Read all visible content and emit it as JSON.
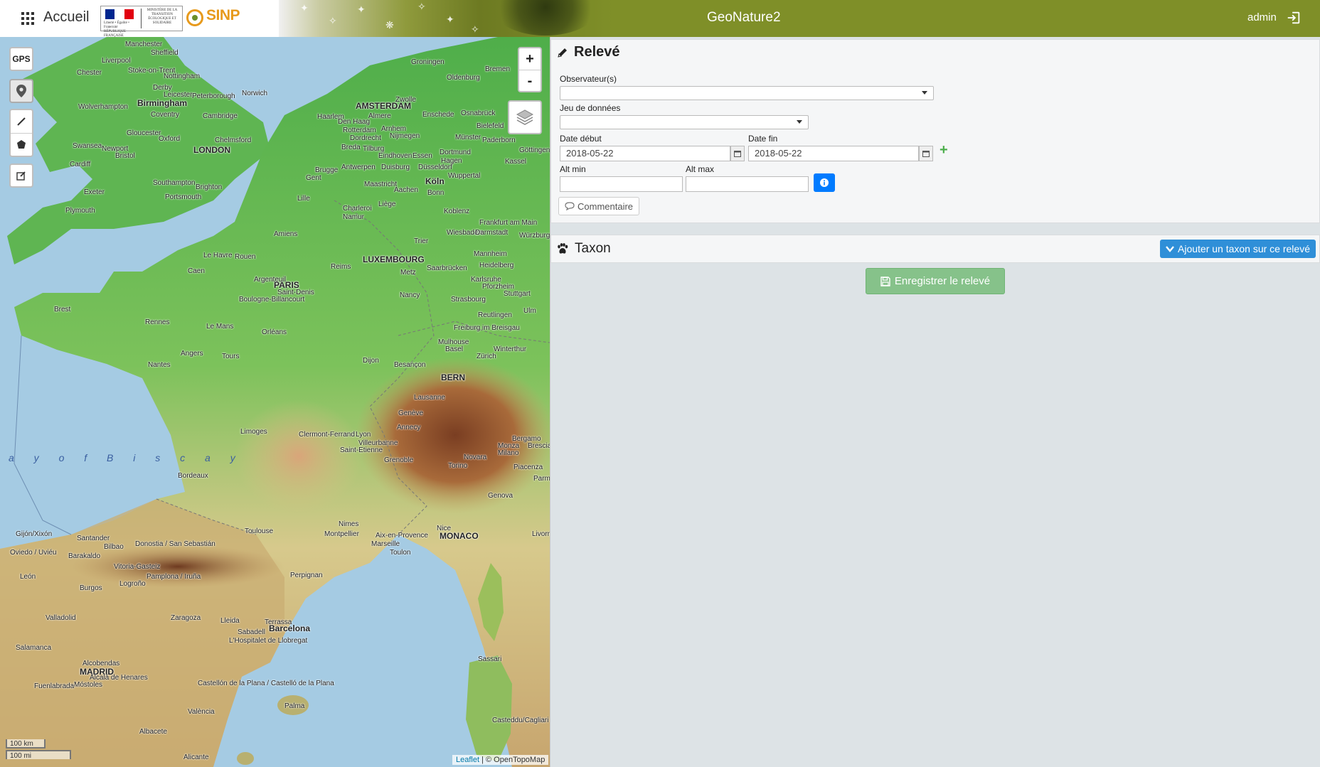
{
  "header": {
    "home_label": "Accueil",
    "app_title": "GeoNature2",
    "user": "admin",
    "logo_sinp": "SINP",
    "logo_rf_text": "Liberté • Égalité • Fraternité RÉPUBLIQUE FRANÇAISE",
    "logo_ministry": "MINISTÈRE DE LA TRANSITION ÉCOLOGIQUE ET SOLIDAIRE",
    "colors": {
      "bar": "#7f8f28",
      "title": "#ffffff"
    }
  },
  "map": {
    "gps_label": "GPS",
    "zoom_in": "+",
    "zoom_out": "-",
    "scale_km": "100 km",
    "scale_mi": "100 mi",
    "attribution_link": "Leaflet",
    "attribution_text": " | © OpenTopoMap",
    "sea_label": "a y   o f   B i s c a y",
    "big_labels": [
      "AMSTERDAM",
      "LONDON",
      "LUXEMBOURG",
      "PARIS",
      "BERN",
      "MONACO",
      "MADRID",
      "Birmingham",
      "Köln",
      "Barcelona"
    ],
    "labels": [
      "Manchester",
      "Sheffield",
      "Liverpool",
      "Chester",
      "Stoke-on-Trent",
      "Nottingham",
      "Derby",
      "Leicester",
      "Peterborough",
      "Norwich",
      "Wolverhampton",
      "Coventry",
      "Cambridge",
      "Gloucester",
      "Oxford",
      "Chelmsford",
      "Swansea",
      "Newport",
      "Bristol",
      "Cardiff",
      "Southampton",
      "Brighton",
      "Portsmouth",
      "Exeter",
      "Plymouth",
      "Groningen",
      "Bremen",
      "Oldenburg",
      "Zwolle",
      "Haarlem",
      "Almere",
      "Den Haag",
      "Rotterdam",
      "Dordrecht",
      "Breda",
      "Tilburg",
      "Eindhoven",
      "Antwerpen",
      "Brugge",
      "Gent",
      "Duisburg",
      "Düsseldorf",
      "Essen",
      "Dortmund",
      "Münster",
      "Bielefeld",
      "Osnabrück",
      "Arnhem",
      "Nijmegen",
      "Enschede",
      "Paderborn",
      "Hagen",
      "Wuppertal",
      "Maastricht",
      "Aachen",
      "Bonn",
      "Liège",
      "Charleroi",
      "Namur",
      "Lille",
      "Koblenz",
      "Frankfurt am Main",
      "Wiesbaden",
      "Darmstadt",
      "Würzburg",
      "Göttingen",
      "Kassel",
      "Trier",
      "Mannheim",
      "Heidelberg",
      "Saarbrücken",
      "Metz",
      "Nancy",
      "Strasbourg",
      "Karlsruhe",
      "Pforzheim",
      "Stuttgart",
      "Reutlingen",
      "Ulm",
      "Freiburg im Breisgau",
      "Mulhouse",
      "Basel",
      "Zürich",
      "Winterthur",
      "Amiens",
      "Le Havre",
      "Rouen",
      "Caen",
      "Argenteuil",
      "Saint-Denis",
      "Boulogne-Billancourt",
      "Reims",
      "Brest",
      "Rennes",
      "Le Mans",
      "Orléans",
      "Angers",
      "Tours",
      "Nantes",
      "Dijon",
      "Besançon",
      "Lausanne",
      "Genève",
      "Annecy",
      "Limoges",
      "Clermont-Ferrand",
      "Lyon",
      "Villeurbanne",
      "Saint-Etienne",
      "Grenoble",
      "Bergamo",
      "Monza",
      "Brescia",
      "Milano",
      "Novara",
      "Torino",
      "Piacenza",
      "Parma",
      "Genova",
      "Bordeaux",
      "Toulouse",
      "Nimes",
      "Montpellier",
      "Aix-en-Provence",
      "Marseille",
      "Toulon",
      "Nice",
      "Livorno",
      "Gijón/Xixón",
      "Oviedo / Uviéu",
      "Santander",
      "Bilbao",
      "Donostia / San Sebastián",
      "Barakaldo",
      "Vitoria-Gasteiz",
      "Pamplona / Iruña",
      "León",
      "Burgos",
      "Logroño",
      "Valladolid",
      "Zaragoza",
      "Lleida",
      "Terrassa",
      "Sabadell",
      "L'Hospitalet de Llobregat",
      "Perpignan",
      "Salamanca",
      "Alcobendas",
      "Alcalá de Henares",
      "Móstoles",
      "Fuenlabrada",
      "Castellón de la Plana / Castelló de la Plana",
      "València",
      "Palma",
      "Albacete",
      "Alicante",
      "Sassari",
      "Cagliari",
      "Casteddu/Cagliari"
    ]
  },
  "releve": {
    "title": "Relevé",
    "observers_label": "Observateur(s)",
    "dataset_label": "Jeu de données",
    "date_start_label": "Date début",
    "date_start_value": "2018-05-22",
    "date_end_label": "Date fin",
    "date_end_value": "2018-05-22",
    "alt_min_label": "Alt min",
    "alt_max_label": "Alt max",
    "comment_label": "Commentaire"
  },
  "taxon": {
    "title": "Taxon",
    "add_label": "Ajouter un taxon sur ce relevé",
    "color": "#2f8fd8"
  },
  "save": {
    "label": "Enregistrer le relevé",
    "color": "#86c28a"
  }
}
